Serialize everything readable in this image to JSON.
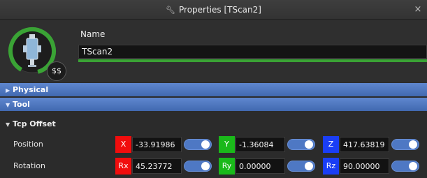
{
  "window": {
    "title": "Properties [TScan2]",
    "close_label": "×"
  },
  "header": {
    "name_label": "Name",
    "name_value": "TScan2",
    "badge_label": "$$",
    "ring_color": "#3aa335"
  },
  "sections": {
    "physical": "Physical",
    "tool": "Tool",
    "tcp_offset": "Tcp Offset"
  },
  "tcp": {
    "position": {
      "label": "Position",
      "x_axis": "X",
      "x_value": "-33.91986",
      "y_axis": "Y",
      "y_value": "-1.36084",
      "z_axis": "Z",
      "z_value": "417.63819"
    },
    "rotation": {
      "label": "Rotation",
      "x_axis": "Rx",
      "x_value": "45.23772",
      "y_axis": "Ry",
      "y_value": "0.00000",
      "z_axis": "Rz",
      "z_value": "90.00000"
    }
  },
  "colors": {
    "accent_blue": "#4e78c4",
    "axis_red": "#f10d0d",
    "axis_green": "#1ab91a",
    "axis_blue": "#1a3ef5"
  }
}
